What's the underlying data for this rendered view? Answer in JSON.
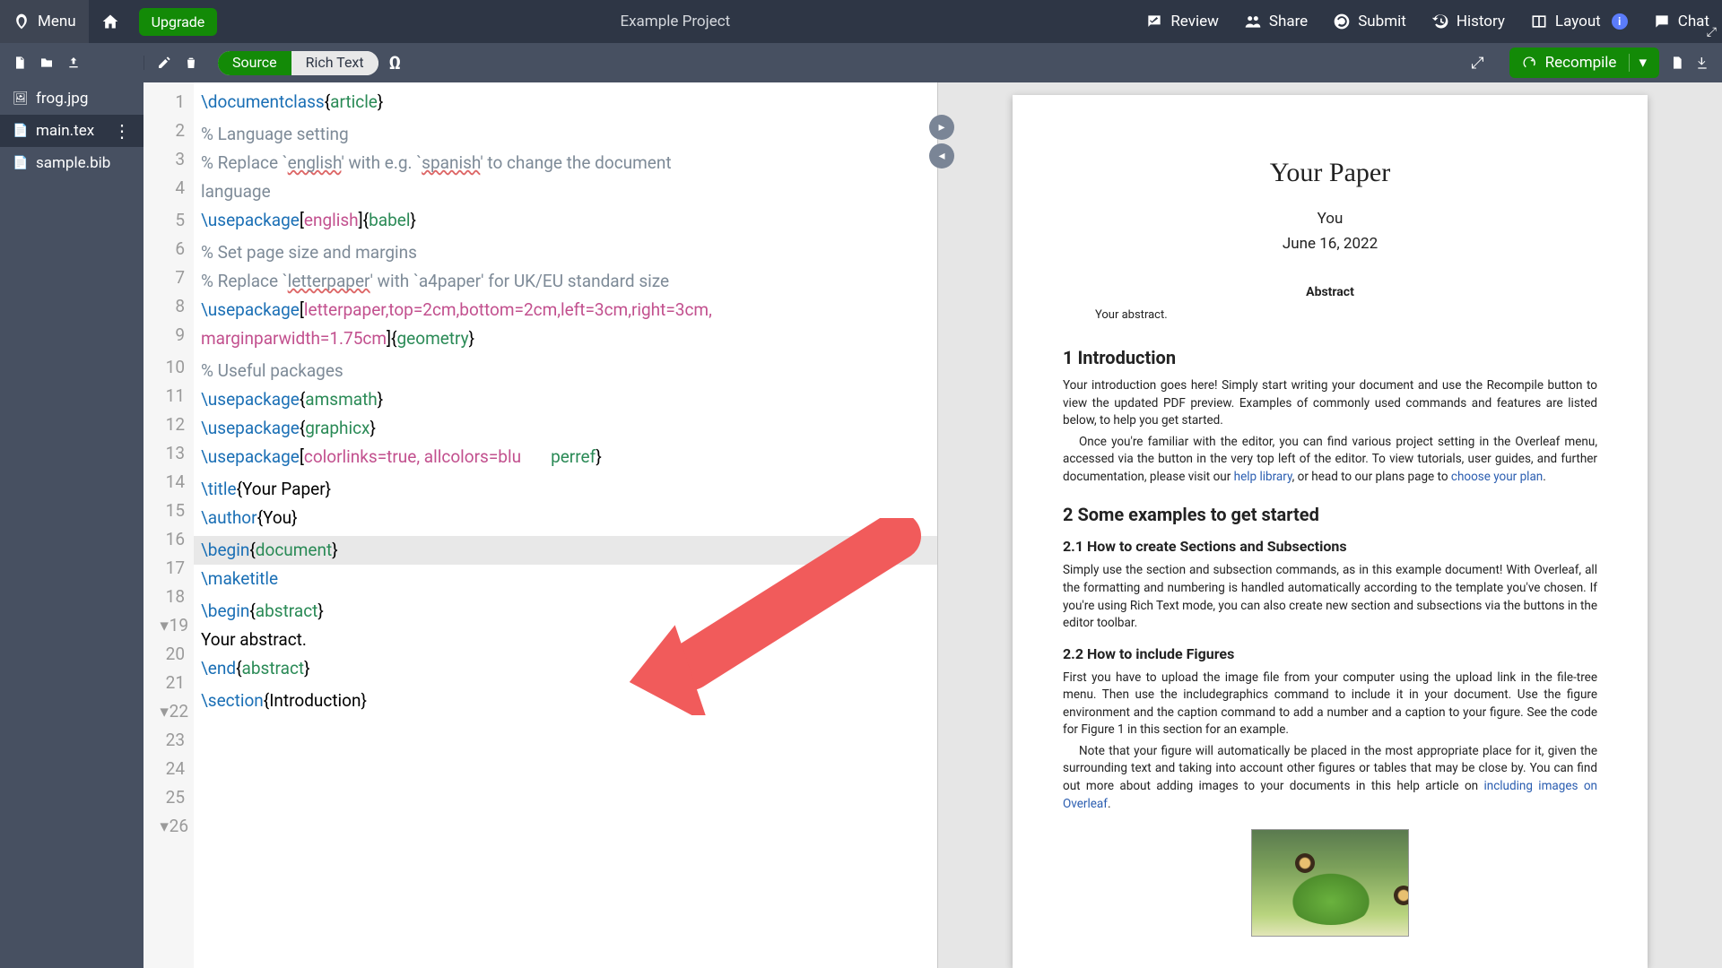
{
  "topbar": {
    "menu": "Menu",
    "upgrade": "Upgrade",
    "title": "Example Project",
    "review": "Review",
    "share": "Share",
    "submit": "Submit",
    "history": "History",
    "layout": "Layout",
    "chat": "Chat"
  },
  "toolbar": {
    "source": "Source",
    "rich": "Rich Text",
    "recompile": "Recompile"
  },
  "files": [
    {
      "name": "frog.jpg",
      "icon": "image"
    },
    {
      "name": "main.tex",
      "icon": "file",
      "active": true
    },
    {
      "name": "sample.bib",
      "icon": "file"
    }
  ],
  "code_lines": [
    {
      "n": 1,
      "seg": [
        [
          "cmd",
          "\\documentclass"
        ],
        [
          "",
          "{"
        ],
        [
          "arg",
          "article"
        ],
        [
          "",
          "}"
        ]
      ]
    },
    {
      "n": 2,
      "seg": [
        [
          "",
          ""
        ]
      ]
    },
    {
      "n": 3,
      "seg": [
        [
          "comment",
          "% Language setting"
        ]
      ]
    },
    {
      "n": 4,
      "seg": [
        [
          "comment",
          "% Replace `"
        ],
        [
          "comment spell",
          "english"
        ],
        [
          "comment",
          "' with e.g. `"
        ],
        [
          "comment spell",
          "spanish"
        ],
        [
          "comment",
          "' to change the document "
        ]
      ]
    },
    {
      "n": "",
      "seg": [
        [
          "comment",
          "language"
        ]
      ]
    },
    {
      "n": 5,
      "seg": [
        [
          "cmd",
          "\\usepackage"
        ],
        [
          "",
          "["
        ],
        [
          "opt",
          "english"
        ],
        [
          "",
          "]{"
        ],
        [
          "arg",
          "babel"
        ],
        [
          "",
          "}"
        ]
      ]
    },
    {
      "n": 6,
      "seg": [
        [
          "",
          ""
        ]
      ]
    },
    {
      "n": 7,
      "seg": [
        [
          "comment",
          "% Set page size and margins"
        ]
      ]
    },
    {
      "n": 8,
      "seg": [
        [
          "comment",
          "% Replace `"
        ],
        [
          "comment spell",
          "letterpaper"
        ],
        [
          "comment",
          "' with `a4paper' for UK/EU standard size"
        ]
      ]
    },
    {
      "n": 9,
      "seg": [
        [
          "cmd",
          "\\usepackage"
        ],
        [
          "",
          "["
        ],
        [
          "opt",
          "letterpaper"
        ],
        [
          "opt",
          ",top=2cm,bottom=2cm,left=3cm,right=3cm,"
        ]
      ]
    },
    {
      "n": "",
      "seg": [
        [
          "opt",
          "marginparwidth=1.75cm"
        ],
        [
          "",
          "]{"
        ],
        [
          "arg",
          "geometry"
        ],
        [
          "",
          "}"
        ]
      ]
    },
    {
      "n": 10,
      "seg": [
        [
          "",
          ""
        ]
      ]
    },
    {
      "n": 11,
      "seg": [
        [
          "comment",
          "% Useful packages"
        ]
      ]
    },
    {
      "n": 12,
      "seg": [
        [
          "cmd",
          "\\usepackage"
        ],
        [
          "",
          "{"
        ],
        [
          "arg",
          "amsmath"
        ],
        [
          "",
          "}"
        ]
      ]
    },
    {
      "n": 13,
      "seg": [
        [
          "cmd",
          "\\usepackage"
        ],
        [
          "",
          "{"
        ],
        [
          "arg",
          "graphicx"
        ],
        [
          "",
          "}"
        ]
      ]
    },
    {
      "n": 14,
      "seg": [
        [
          "cmd",
          "\\usepackage"
        ],
        [
          "",
          "["
        ],
        [
          "opt",
          "colorlinks=true"
        ],
        [
          "opt",
          ", allcolors=blu"
        ],
        [
          "",
          "       "
        ],
        [
          "arg",
          "perref"
        ],
        [
          "",
          "}"
        ]
      ]
    },
    {
      "n": 15,
      "seg": [
        [
          "",
          ""
        ]
      ]
    },
    {
      "n": 16,
      "seg": [
        [
          "cmd",
          "\\title"
        ],
        [
          "",
          "{Your Paper}"
        ]
      ]
    },
    {
      "n": 17,
      "seg": [
        [
          "cmd",
          "\\author"
        ],
        [
          "",
          "{You}"
        ]
      ]
    },
    {
      "n": 18,
      "seg": [
        [
          "",
          ""
        ]
      ]
    },
    {
      "n": 19,
      "hl": true,
      "fold": true,
      "seg": [
        [
          "cmd",
          "\\begin"
        ],
        [
          "",
          "{"
        ],
        [
          "arg",
          "document"
        ],
        [
          "",
          "}"
        ]
      ]
    },
    {
      "n": 20,
      "seg": [
        [
          "cmd",
          "\\maketitle"
        ]
      ]
    },
    {
      "n": 21,
      "seg": [
        [
          "",
          ""
        ]
      ]
    },
    {
      "n": 22,
      "fold": true,
      "seg": [
        [
          "cmd",
          "\\begin"
        ],
        [
          "",
          "{"
        ],
        [
          "arg",
          "abstract"
        ],
        [
          "",
          "}"
        ]
      ]
    },
    {
      "n": 23,
      "seg": [
        [
          "",
          "Your abstract."
        ]
      ]
    },
    {
      "n": 24,
      "seg": [
        [
          "cmd",
          "\\end"
        ],
        [
          "",
          "{"
        ],
        [
          "arg",
          "abstract"
        ],
        [
          "",
          "}"
        ]
      ]
    },
    {
      "n": 25,
      "seg": [
        [
          "",
          ""
        ]
      ]
    },
    {
      "n": 26,
      "fold": true,
      "seg": [
        [
          "cmd",
          "\\section"
        ],
        [
          "",
          "{Introduction}"
        ]
      ]
    }
  ],
  "pdf": {
    "title": "Your Paper",
    "author": "You",
    "date": "June 16, 2022",
    "abstract_h": "Abstract",
    "abstract": "Your abstract.",
    "sec1": "1    Introduction",
    "p1a": "Your introduction goes here! Simply start writing your document and use the Recompile button to view the updated PDF preview. Examples of commonly used commands and features are listed below, to help you get started.",
    "p1b": "Once you're familiar with the editor, you can find various project setting in the Overleaf menu, accessed via the button in the very top left of the editor. To view tutorials, user guides, and further documentation, please visit our ",
    "p1b_link1": "help library",
    "p1b_mid": ", or head to our plans page to ",
    "p1b_link2": "choose your plan",
    "p1b_end": ".",
    "sec2": "2    Some examples to get started",
    "sub21": "2.1    How to create Sections and Subsections",
    "p21": "Simply use the section and subsection commands, as in this example document! With Overleaf, all the formatting and numbering is handled automatically according to the template you've chosen. If you're using Rich Text mode, you can also create new section and subsections via the buttons in the editor toolbar.",
    "sub22": "2.2    How to include Figures",
    "p22a": "First you have to upload the image file from your computer using the upload link in the file-tree menu. Then use the includegraphics command to include it in your document. Use the figure environment and the caption command to add a number and a caption to your figure. See the code for Figure 1 in this section for an example.",
    "p22b": "Note that your figure will automatically be placed in the most appropriate place for it, given the surrounding text and taking into account other figures or tables that may be close by. You can find out more about adding images to your documents in this help article on ",
    "p22b_link": "including images on Overleaf",
    "p22b_end": "."
  }
}
